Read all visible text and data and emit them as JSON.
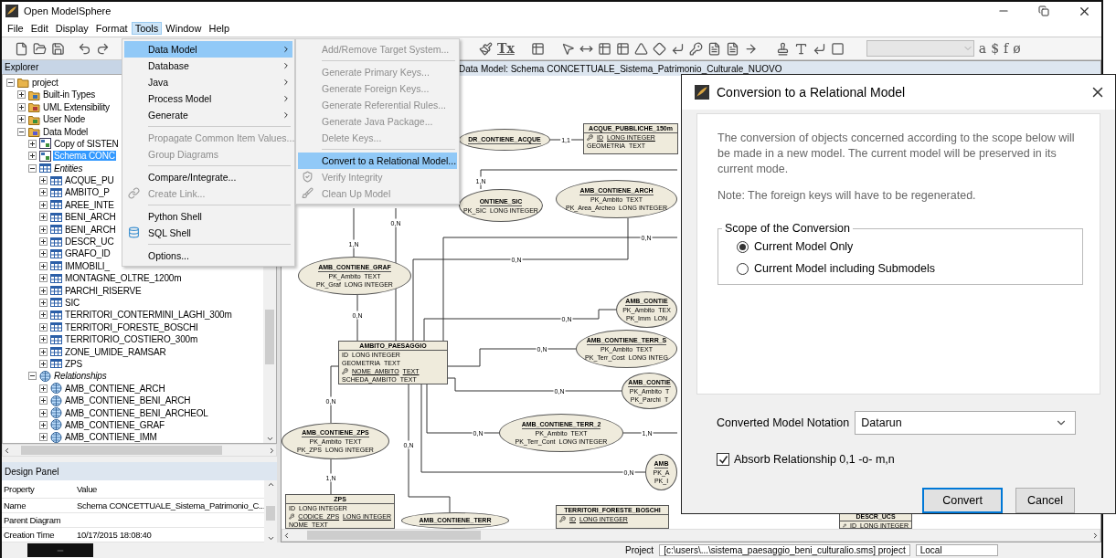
{
  "window": {
    "title": "Open ModelSphere"
  },
  "menubar": [
    {
      "label": "File",
      "selected": false
    },
    {
      "label": "Edit",
      "selected": false
    },
    {
      "label": "Display",
      "selected": false
    },
    {
      "label": "Format",
      "selected": false
    },
    {
      "label": "Tools",
      "selected": true
    },
    {
      "label": "Window",
      "selected": false
    },
    {
      "label": "Help",
      "selected": false
    }
  ],
  "toolbar": {
    "format_glyph": "Tx",
    "text_glyphs": [
      "a",
      "$",
      "f",
      "ø"
    ]
  },
  "tools_menu": {
    "items": [
      {
        "kind": "item",
        "label": "Data Model",
        "submenu": true,
        "selected": true,
        "disabled": false
      },
      {
        "kind": "item",
        "label": "Database",
        "submenu": true,
        "selected": false,
        "disabled": false
      },
      {
        "kind": "item",
        "label": "Java",
        "submenu": true,
        "selected": false,
        "disabled": false
      },
      {
        "kind": "item",
        "label": "Process Model",
        "submenu": true,
        "selected": false,
        "disabled": false
      },
      {
        "kind": "item",
        "label": "Generate",
        "submenu": true,
        "selected": false,
        "disabled": false
      },
      {
        "kind": "separator"
      },
      {
        "kind": "item",
        "label": "Propagate Common Item Values...",
        "submenu": false,
        "selected": false,
        "disabled": true
      },
      {
        "kind": "item",
        "label": "Group Diagrams",
        "submenu": false,
        "selected": false,
        "disabled": true
      },
      {
        "kind": "separator"
      },
      {
        "kind": "item",
        "label": "Compare/Integrate...",
        "submenu": false,
        "selected": false,
        "disabled": false
      },
      {
        "kind": "item",
        "label": "Create Link...",
        "submenu": false,
        "selected": false,
        "disabled": true
      },
      {
        "kind": "separator"
      },
      {
        "kind": "item",
        "label": "Python Shell",
        "submenu": false,
        "selected": false,
        "disabled": false
      },
      {
        "kind": "item",
        "label": "SQL Shell",
        "submenu": false,
        "selected": false,
        "disabled": false
      },
      {
        "kind": "separator"
      },
      {
        "kind": "item",
        "label": "Options...",
        "submenu": false,
        "selected": false,
        "disabled": false
      }
    ]
  },
  "data_model_menu": {
    "items": [
      {
        "kind": "item",
        "label": "Add/Remove Target System...",
        "selected": false,
        "disabled": true
      },
      {
        "kind": "separator"
      },
      {
        "kind": "item",
        "label": "Generate Primary Keys...",
        "selected": false,
        "disabled": true
      },
      {
        "kind": "item",
        "label": "Generate Foreign Keys...",
        "selected": false,
        "disabled": true
      },
      {
        "kind": "item",
        "label": "Generate Referential Rules...",
        "selected": false,
        "disabled": true
      },
      {
        "kind": "item",
        "label": "Generate Java Package...",
        "selected": false,
        "disabled": true
      },
      {
        "kind": "item",
        "label": "Delete Keys...",
        "selected": false,
        "disabled": true
      },
      {
        "kind": "separator"
      },
      {
        "kind": "item",
        "label": "Convert to a Relational Model...",
        "selected": true,
        "disabled": false
      },
      {
        "kind": "item",
        "label": "Verify Integrity",
        "selected": false,
        "disabled": true
      },
      {
        "kind": "item",
        "label": "Clean Up Model",
        "selected": false,
        "disabled": true
      }
    ]
  },
  "explorer": {
    "title": "Explorer",
    "tree": [
      {
        "label": "project",
        "kind": "project",
        "expanded": true,
        "selected": false,
        "children": [
          {
            "label": "Built-in Types",
            "kind": "types",
            "expanded": false,
            "selected": false
          },
          {
            "label": "UML Extensibility",
            "kind": "extensibility",
            "expanded": false,
            "selected": false
          },
          {
            "label": "User Node",
            "kind": "user",
            "expanded": false,
            "selected": false
          },
          {
            "label": "Data Model",
            "kind": "model",
            "expanded": true,
            "selected": false,
            "children": [
              {
                "label": "Copy of SISTEN",
                "kind": "diagram",
                "expanded": false,
                "selected": false
              },
              {
                "label": "Schema CONC",
                "kind": "diagram",
                "expanded": false,
                "selected": true
              },
              {
                "label": "Entities",
                "kind": "entities",
                "expanded": true,
                "selected": false,
                "children": [
                  {
                    "label": "ACQUE_PU",
                    "kind": "entity",
                    "expanded": false,
                    "selected": false
                  },
                  {
                    "label": "AMBITO_P",
                    "kind": "entity",
                    "expanded": false,
                    "selected": false
                  },
                  {
                    "label": "AREE_INTE",
                    "kind": "entity",
                    "expanded": false,
                    "selected": false
                  },
                  {
                    "label": "BENI_ARCH",
                    "kind": "entity",
                    "expanded": false,
                    "selected": false
                  },
                  {
                    "label": "BENI_ARCH",
                    "kind": "entity",
                    "expanded": false,
                    "selected": false
                  },
                  {
                    "label": "DESCR_UC",
                    "kind": "entity",
                    "expanded": false,
                    "selected": false
                  },
                  {
                    "label": "GRAFO_ID",
                    "kind": "entity",
                    "expanded": false,
                    "selected": false
                  },
                  {
                    "label": "IMMOBILI_",
                    "kind": "entity",
                    "expanded": false,
                    "selected": false
                  },
                  {
                    "label": "MONTAGNE_OLTRE_1200m",
                    "kind": "entity",
                    "expanded": false,
                    "selected": false
                  },
                  {
                    "label": "PARCHI_RISERVE",
                    "kind": "entity",
                    "expanded": false,
                    "selected": false
                  },
                  {
                    "label": "SIC",
                    "kind": "entity",
                    "expanded": false,
                    "selected": false
                  },
                  {
                    "label": "TERRITORI_CONTERMINI_LAGHI_300m",
                    "kind": "entity",
                    "expanded": false,
                    "selected": false
                  },
                  {
                    "label": "TERRITORI_FORESTE_BOSCHI",
                    "kind": "entity",
                    "expanded": false,
                    "selected": false
                  },
                  {
                    "label": "TERRITORIO_COSTIERO_300m",
                    "kind": "entity",
                    "expanded": false,
                    "selected": false
                  },
                  {
                    "label": "ZONE_UMIDE_RAMSAR",
                    "kind": "entity",
                    "expanded": false,
                    "selected": false
                  },
                  {
                    "label": "ZPS",
                    "kind": "entity",
                    "expanded": false,
                    "selected": false
                  }
                ]
              },
              {
                "label": "Relationships",
                "kind": "relationships",
                "expanded": true,
                "selected": false,
                "children": [
                  {
                    "label": "AMB_CONTIENE_ARCH",
                    "kind": "relationship",
                    "expanded": false,
                    "selected": false
                  },
                  {
                    "label": "AMB_CONTIENE_BENI_ARCH",
                    "kind": "relationship",
                    "expanded": false,
                    "selected": false
                  },
                  {
                    "label": "AMB_CONTIENE_BENI_ARCHEOL",
                    "kind": "relationship",
                    "expanded": false,
                    "selected": false
                  },
                  {
                    "label": "AMB_CONTIENE_GRAF",
                    "kind": "relationship",
                    "expanded": false,
                    "selected": false
                  },
                  {
                    "label": "AMB_CONTIENE_IMM",
                    "kind": "relationship",
                    "expanded": false,
                    "selected": false
                  }
                ]
              }
            ]
          }
        ]
      }
    ]
  },
  "design_panel": {
    "title": "Design Panel",
    "columns": [
      "Property",
      "Value"
    ],
    "rows": [
      {
        "property": "Name",
        "value": "Schema CONCETTUALE_Sistema_Patrimonio_C..."
      },
      {
        "property": "Parent Diagram"
      },
      {
        "property": "Creation Time",
        "value": "10/17/2015 18:08:40"
      }
    ]
  },
  "diagram": {
    "title": "Data Model: Schema CONCETTUALE_Sistema_Patrimonio_Culturale_NUOVO",
    "nodes": [
      {
        "kind": "relationship",
        "name": "DR_CONTIENE_ACQUE"
      },
      {
        "kind": "entity",
        "name": "ACQUE_PUBBLICHE_150m",
        "rows": [
          {
            "name": "ID",
            "type": "LONG INTEGER",
            "key": true
          },
          {
            "name": "GEOMETRIA",
            "type": "TEXT",
            "key": false
          }
        ]
      },
      {
        "kind": "relationship",
        "name": "ONTIENE_SIC",
        "rows": [
          {
            "name": "PK_SIC",
            "type": "LONG INTEGER"
          }
        ]
      },
      {
        "kind": "relationship",
        "name": "AMB_CONTIENE_ARCH",
        "rows": [
          {
            "name": "PK_Ambito",
            "type": "TEXT"
          },
          {
            "name": "PK_Area_Archeo",
            "type": "LONG INTEGER"
          }
        ]
      },
      {
        "kind": "relationship",
        "name": "AMB_CONTIENE_GRAF",
        "rows": [
          {
            "name": "PK_Ambito",
            "type": "TEXT"
          },
          {
            "name": "PK_Graf",
            "type": "LONG INTEGER"
          }
        ]
      },
      {
        "kind": "relationship",
        "name": "AMB_CONTIE",
        "rows": [
          {
            "name": "PK_Ambito",
            "type": "TEX"
          },
          {
            "name": "PK_Imm",
            "type": "LON"
          }
        ]
      },
      {
        "kind": "relationship",
        "name": "AMB_CONTIENE_TERR_S",
        "rows": [
          {
            "name": "PK_Ambito",
            "type": "TEXT"
          },
          {
            "name": "PK_Terr_Cost",
            "type": "LONG INTEG"
          }
        ]
      },
      {
        "kind": "relationship",
        "name": "AMB_CONTIE",
        "rows": [
          {
            "name": "PK_Ambito",
            "type": "T"
          },
          {
            "name": "PK_Parchi",
            "type": "T"
          }
        ]
      },
      {
        "kind": "entity",
        "name": "AMBITO_PAESAGGIO",
        "rows": [
          {
            "name": "ID",
            "type": "LONG INTEGER",
            "key": false
          },
          {
            "name": "GEOMETRIA",
            "type": "TEXT",
            "key": false
          },
          {
            "name": "NOME_AMBITO",
            "type": "TEXT",
            "key": true
          },
          {
            "name": "SCHEDA_AMBITO",
            "type": "TEXT",
            "key": false
          }
        ]
      },
      {
        "kind": "relationship",
        "name": "AMB_CONTIENE_TERR_2",
        "rows": [
          {
            "name": "PK_Ambito",
            "type": "TEXT"
          },
          {
            "name": "PK_Terr_Cont",
            "type": "LONG INTEGER"
          }
        ]
      },
      {
        "kind": "relationship",
        "name": "AMB_CONTIENE_ZPS",
        "rows": [
          {
            "name": "PK_Ambito",
            "type": "TEXT"
          },
          {
            "name": "PK_ZPS",
            "type": "LONG INTEGER"
          }
        ]
      },
      {
        "kind": "relationship",
        "name": "AMB",
        "rows": [
          {
            "name": "PK_A"
          },
          {
            "name": "PK_I"
          }
        ]
      },
      {
        "kind": "entity",
        "name": "ZPS",
        "rows": [
          {
            "name": "ID",
            "type": "LONG INTEGER",
            "key": false
          },
          {
            "name": "CODICE_ZPS",
            "type": "LONG INTEGER",
            "key": true
          },
          {
            "name": "NOME",
            "type": "TEXT",
            "key": false
          }
        ]
      },
      {
        "kind": "relationship",
        "name": "AMB_CONTIENE_TERR"
      },
      {
        "kind": "entity",
        "name": "TERRITORI_FORESTE_BOSCHI",
        "rows": [
          {
            "name": "ID",
            "type": "LONG INTEGER",
            "key": true
          }
        ]
      },
      {
        "kind": "entity",
        "name": "DESCR_UCS",
        "rows": [
          {
            "name": "ID",
            "type": "LONG INTEGER",
            "key": true
          }
        ]
      }
    ],
    "cardinalities": [
      "1,1",
      "1,N",
      "0,N",
      "0,N",
      "1,N",
      "0,N",
      "0,N",
      "0,N",
      "0,N",
      "0,N",
      "0,N",
      "1,N",
      "0,N",
      "0,N",
      "1,N",
      "0,N"
    ]
  },
  "dialog": {
    "title": "Conversion to a Relational Model",
    "description": "The conversion of objects concerned according to the scope below will be made in a new model. The current model will be preserved in its current mode.",
    "note": "Note: The foreign keys will have to be regenerated.",
    "scope": {
      "title": "Scope of the Conversion",
      "options": [
        {
          "label": "Current Model Only",
          "selected": true
        },
        {
          "label": "Current Model including Submodels",
          "selected": false
        }
      ]
    },
    "notation": {
      "label": "Converted Model Notation",
      "value": "Datarun"
    },
    "absorb": {
      "label": "Absorb Relationship 0,1 -o- m,n",
      "checked": true
    },
    "buttons": [
      {
        "label": "Convert",
        "default": true
      },
      {
        "label": "Cancel",
        "default": false
      }
    ]
  },
  "status_bar": [
    "Project",
    "[c:\\users\\...\\sistema_paesaggio_beni_culturalio.sms] project",
    "Local"
  ]
}
